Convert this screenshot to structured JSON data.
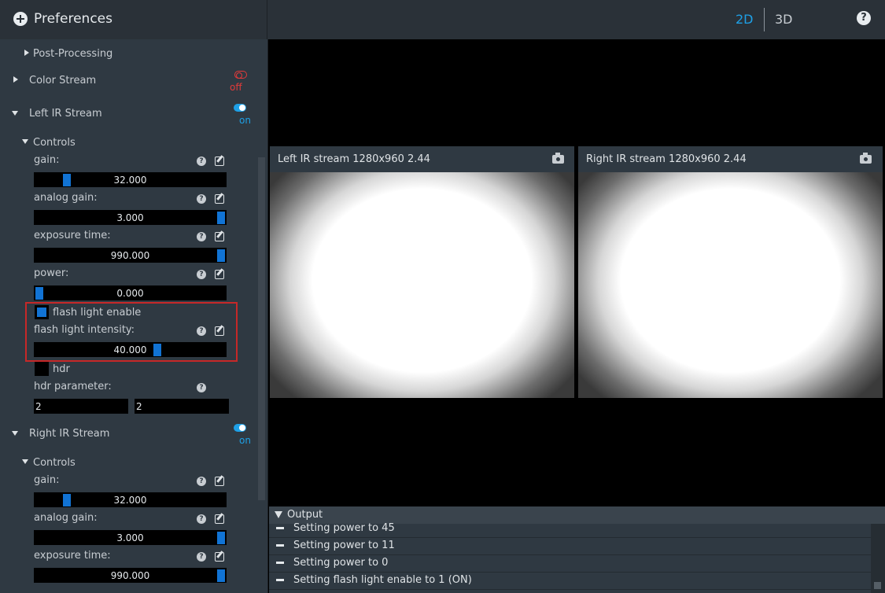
{
  "header": {
    "title": "Preferences",
    "view_2d": "2D",
    "view_3d": "3D"
  },
  "sidebar": {
    "post_processing": "Post-Processing",
    "color_stream": {
      "label": "Color Stream",
      "state": "off"
    },
    "left_ir": {
      "label": "Left IR Stream",
      "state": "on",
      "controls": "Controls",
      "gain": {
        "label": "gain:",
        "value": "32.000",
        "fraction": 0.15
      },
      "analog_gain": {
        "label": "analog gain:",
        "value": "3.000",
        "fraction": 1.0
      },
      "exposure": {
        "label": "exposure time:",
        "value": "990.000",
        "fraction": 1.0
      },
      "power": {
        "label": "power:",
        "value": "0.000",
        "fraction": 0.0
      },
      "flash_enable": {
        "label": "flash light enable",
        "checked": true
      },
      "flash_intensity": {
        "label": "flash light intensity:",
        "value": "40.000",
        "fraction": 0.65
      },
      "hdr": {
        "label": "hdr",
        "checked": false
      },
      "hdr_param": {
        "label": "hdr parameter:",
        "v1": "2",
        "v2": "2"
      }
    },
    "right_ir": {
      "label": "Right IR Stream",
      "state": "on",
      "controls": "Controls",
      "gain": {
        "label": "gain:",
        "value": "32.000",
        "fraction": 0.15
      },
      "analog_gain": {
        "label": "analog gain:",
        "value": "3.000",
        "fraction": 1.0
      },
      "exposure": {
        "label": "exposure time:",
        "value": "990.000",
        "fraction": 1.0
      }
    }
  },
  "streams": [
    {
      "title": "Left IR stream  1280x960  2.44"
    },
    {
      "title": "Right IR stream  1280x960  2.44"
    }
  ],
  "output": {
    "title": "Output",
    "lines": [
      "Setting power to 45",
      "Setting power to 11",
      "Setting power to 0",
      "Setting flash light enable to 1 (ON)"
    ]
  },
  "colors": {
    "accent": "#1ea0e6",
    "off": "#e33a3a",
    "slider_knob": "#1173d4",
    "highlight": "#c62828"
  },
  "icons": [
    "plus-circle-icon",
    "help-icon",
    "question-icon",
    "edit-icon",
    "camera-icon",
    "toggle-icon"
  ]
}
